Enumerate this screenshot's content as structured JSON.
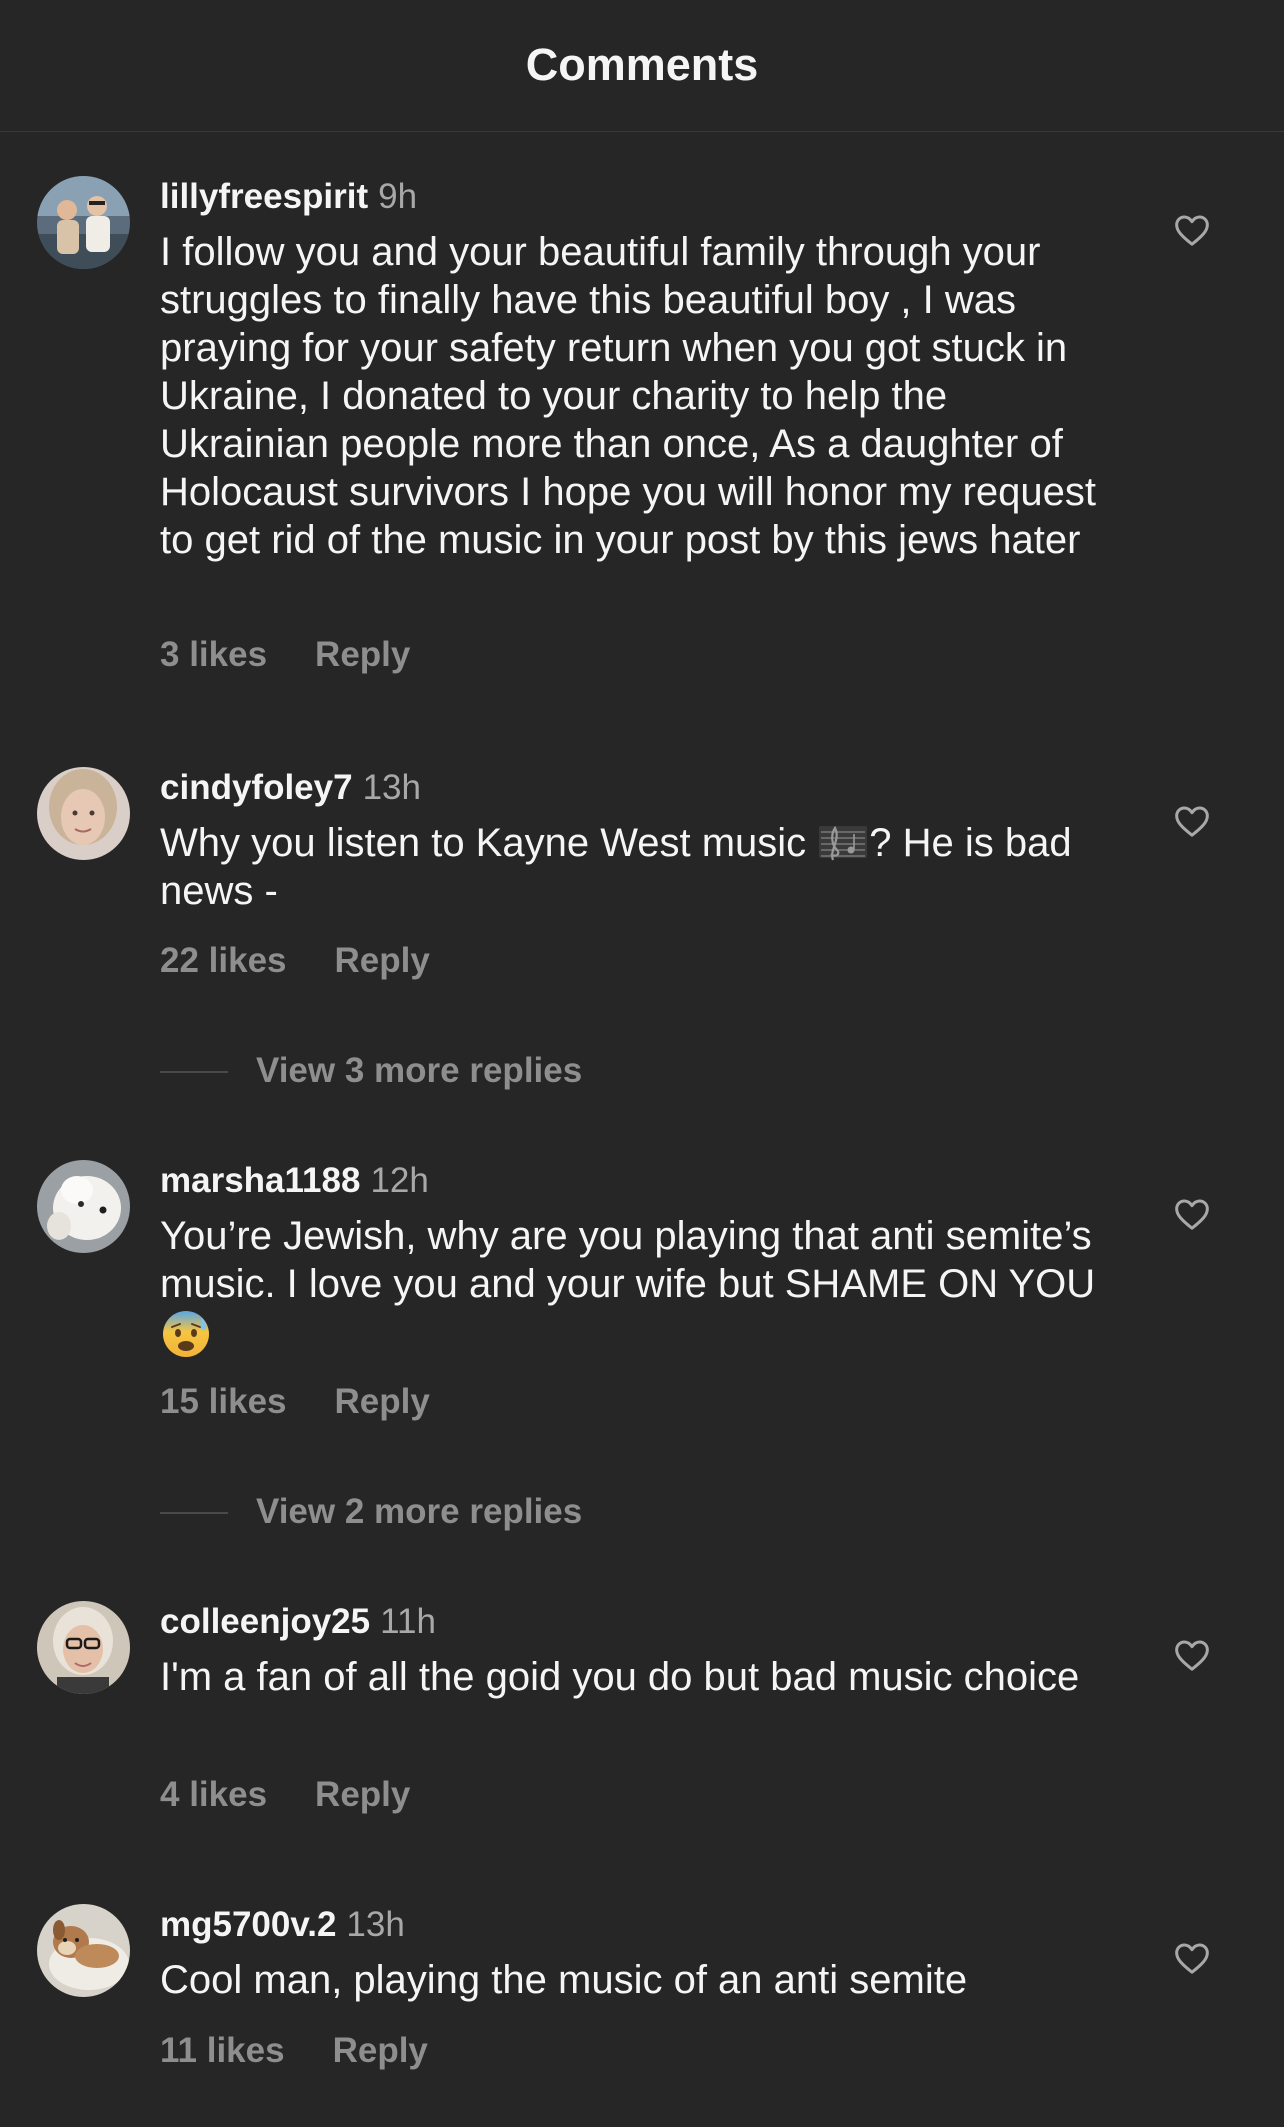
{
  "header": {
    "title": "Comments"
  },
  "comments": [
    {
      "username": "lillyfreespirit",
      "time": "9h",
      "text": "I follow you and your beautiful family through your struggles to finally have this beautiful boy , I was praying for your safety return when you got stuck in Ukraine, I donated to your charity to help the Ukrainian people more than once, As a daughter of Holocaust survivors I hope you will honor my request to get rid of the music in your post by this jews hater",
      "likes": "3 likes",
      "reply": "Reply",
      "avatar_color": "#6b7a86"
    },
    {
      "username": "cindyfoley7",
      "time": "13h",
      "text_before": "Why you listen to Kayne West music ",
      "emoji": "musical-score-emoji",
      "text_after": "? He is bad news -",
      "likes": "22 likes",
      "reply": "Reply",
      "view_more": "View 3 more replies",
      "avatar_color": "#c9a892"
    },
    {
      "username": "marsha1188",
      "time": "12h",
      "text": "You’re Jewish, why are you playing that anti semite’s music. I love you and your wife but SHAME ON YOU",
      "emoji": "anxious-face-with-sweat-emoji",
      "likes": "15 likes",
      "reply": "Reply",
      "view_more": "View 2 more replies",
      "avatar_color": "#e8e4df"
    },
    {
      "username": "colleenjoy25",
      "time": "11h",
      "text": "I'm a fan of all the goid you do but bad music choice",
      "likes": "4 likes",
      "reply": "Reply",
      "avatar_color": "#d8d0c6"
    },
    {
      "username": "mg5700v.2",
      "time": "13h",
      "text": "Cool man, playing the music of an anti semite",
      "likes": "11 likes",
      "reply": "Reply",
      "avatar_color": "#b79a7e"
    }
  ]
}
